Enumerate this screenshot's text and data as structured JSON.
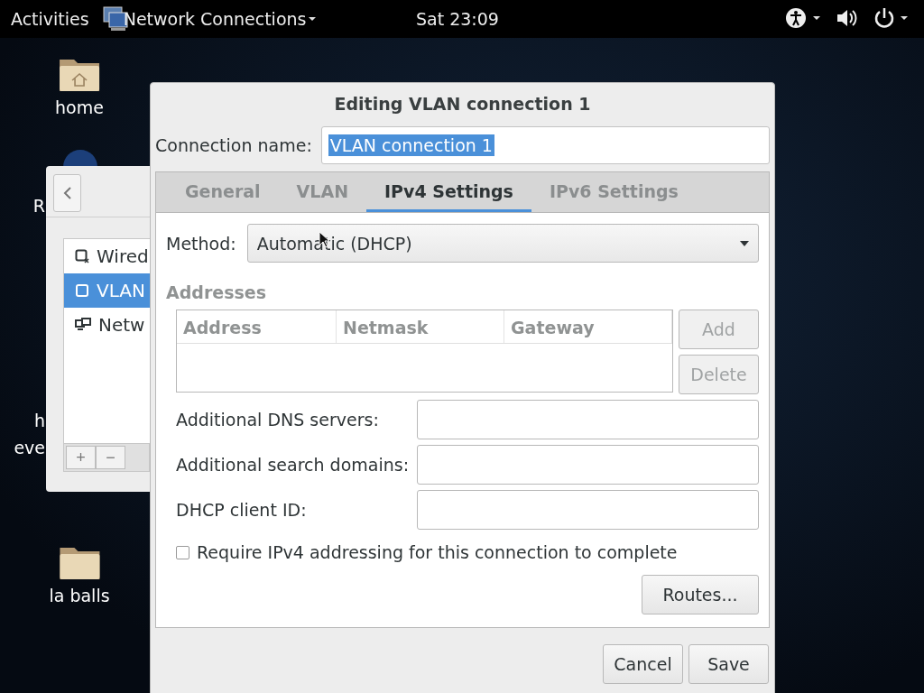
{
  "top_bar": {
    "activities": "Activities",
    "app_menu": "Network Connections",
    "clock": "Sat 23:09"
  },
  "desktop": {
    "icons": [
      {
        "label": "home",
        "kind": "home"
      },
      {
        "label": "R",
        "kind": "app"
      },
      {
        "label": "h",
        "kind": "hidden"
      },
      {
        "label": "eve",
        "kind": "hidden"
      },
      {
        "label": "la balls",
        "kind": "folder"
      }
    ]
  },
  "back_window": {
    "items": [
      {
        "label": "Wired",
        "kind": "wired",
        "selected": false
      },
      {
        "label": "VLAN",
        "kind": "vlan",
        "selected": true
      },
      {
        "label": "Netw",
        "kind": "network",
        "selected": false
      }
    ],
    "toolbar": [
      "+",
      "−"
    ]
  },
  "dialog": {
    "title": "Editing VLAN connection 1",
    "connection_name": {
      "label": "Connection name:",
      "value": "VLAN connection 1"
    },
    "tabs": [
      {
        "label": "General",
        "selected": false
      },
      {
        "label": "VLAN",
        "selected": false
      },
      {
        "label": "IPv4 Settings",
        "selected": true
      },
      {
        "label": "IPv6 Settings",
        "selected": false
      }
    ],
    "method": {
      "label": "Method:",
      "value": "Automatic (DHCP)"
    },
    "addresses": {
      "heading": "Addresses",
      "columns": [
        "Address",
        "Netmask",
        "Gateway"
      ],
      "buttons": [
        {
          "label": "Add",
          "disabled": true
        },
        {
          "label": "Delete",
          "disabled": true
        }
      ]
    },
    "fields": [
      {
        "label": "Additional DNS servers:"
      },
      {
        "label": "Additional search domains:"
      },
      {
        "label": "DHCP client ID:"
      }
    ],
    "require": {
      "label": "Require IPv4 addressing for this connection to complete",
      "checked": false
    },
    "routes_button": "Routes...",
    "buttons": [
      "Cancel",
      "Save"
    ]
  }
}
